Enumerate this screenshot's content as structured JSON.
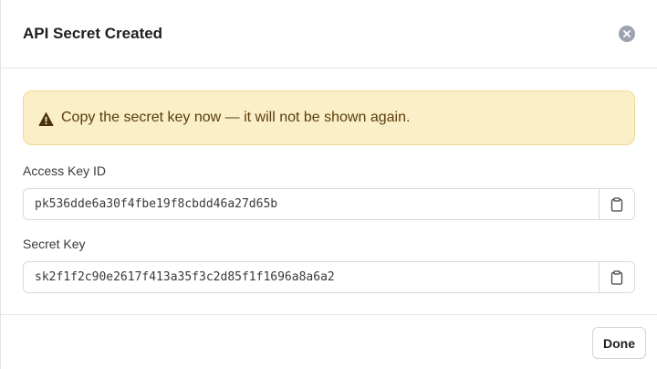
{
  "dialog": {
    "title": "API Secret Created",
    "close_icon": "close-circle-icon"
  },
  "warning": {
    "icon": "warning-triangle-icon",
    "text": "Copy the secret key now — it will not be shown again.",
    "background": "#fbefc8",
    "text_color": "#5a3d0c"
  },
  "access_key": {
    "label": "Access Key ID",
    "value": "pk536dde6a30f4fbe19f8cbdd46a27d65b",
    "copy_icon": "clipboard-icon"
  },
  "secret_key": {
    "label": "Secret Key",
    "value": "sk2f1f2c90e2617f413a35f3c2d85f1f1696a8a6a2",
    "copy_icon": "clipboard-icon"
  },
  "footer": {
    "done_label": "Done"
  }
}
